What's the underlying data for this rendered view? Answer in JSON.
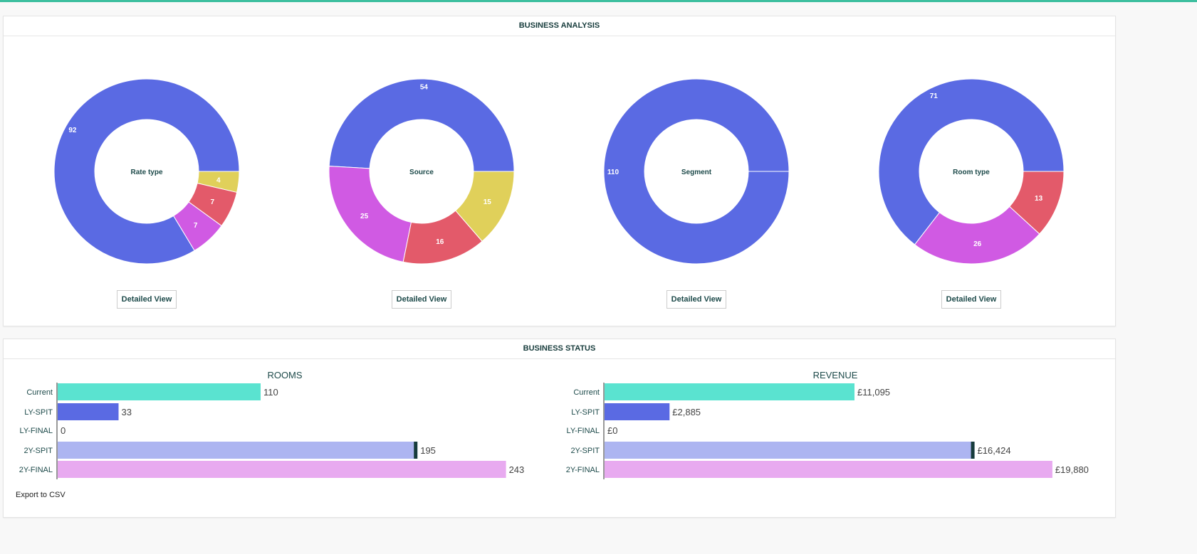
{
  "analysis": {
    "title": "BUSINESS ANALYSIS",
    "button_label": "Detailed View"
  },
  "status": {
    "title": "BUSINESS STATUS",
    "export_label": "Export to CSV"
  },
  "colors": {
    "blue": "#5a6ae3",
    "magenta": "#d05ae3",
    "red": "#e35a6a",
    "yellow": "#e0d05a",
    "teal": "#5ae3d0",
    "lightblue": "#adb5f1",
    "pink": "#e8aaf0",
    "marker": "#173c3c"
  },
  "chart_data": [
    {
      "type": "pie",
      "title": "Rate type",
      "values": [
        92,
        7,
        7,
        4
      ],
      "colors": [
        "#5a6ae3",
        "#d05ae3",
        "#e35a6a",
        "#e0d05a"
      ]
    },
    {
      "type": "pie",
      "title": "Source",
      "values": [
        54,
        25,
        16,
        15
      ],
      "colors": [
        "#5a6ae3",
        "#d05ae3",
        "#e35a6a",
        "#e0d05a"
      ]
    },
    {
      "type": "pie",
      "title": "Segment",
      "values": [
        110
      ],
      "colors": [
        "#5a6ae3"
      ]
    },
    {
      "type": "pie",
      "title": "Room type",
      "values": [
        71,
        26,
        13
      ],
      "colors": [
        "#5a6ae3",
        "#d05ae3",
        "#e35a6a"
      ]
    },
    {
      "type": "bar",
      "title": "ROOMS",
      "categories": [
        "Current",
        "LY-SPIT",
        "LY-FINAL",
        "2Y-SPIT",
        "2Y-FINAL"
      ],
      "values": [
        110,
        33,
        0,
        195,
        243
      ],
      "labels": [
        "110",
        "33",
        "0",
        "195",
        "243"
      ],
      "colors": [
        "#5ae3d0",
        "#5a6ae3",
        "#5a6ae3",
        "#adb5f1",
        "#e8aaf0"
      ],
      "marker_index": 3
    },
    {
      "type": "bar",
      "title": "REVENUE",
      "categories": [
        "Current",
        "LY-SPIT",
        "LY-FINAL",
        "2Y-SPIT",
        "2Y-FINAL"
      ],
      "values": [
        11095,
        2885,
        0,
        16424,
        19880
      ],
      "labels": [
        "£11,095",
        "£2,885",
        "£0",
        "£16,424",
        "£19,880"
      ],
      "colors": [
        "#5ae3d0",
        "#5a6ae3",
        "#5a6ae3",
        "#adb5f1",
        "#e8aaf0"
      ],
      "marker_index": 3
    }
  ]
}
